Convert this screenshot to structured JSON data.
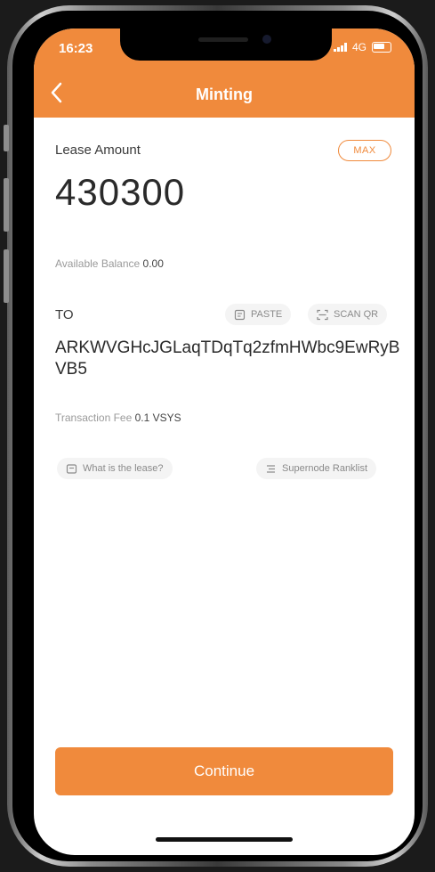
{
  "status_bar": {
    "time": "16:23",
    "network": "4G"
  },
  "header": {
    "title": "Minting",
    "back_icon": "chevron-left-icon"
  },
  "lease": {
    "label": "Lease Amount",
    "max_label": "MAX",
    "amount": "430300",
    "available_label": "Available Balance",
    "available_value": "0.00"
  },
  "to": {
    "label": "TO",
    "paste_label": "PASTE",
    "scan_label": "SCAN QR",
    "address": "ARKWVGHcJGLaqTDqTq2zfmHWbc9EwRyBVB5"
  },
  "fee": {
    "label": "Transaction Fee",
    "value": "0.1 VSYS"
  },
  "links": {
    "lease_help": "What is the lease?",
    "supernode": "Supernode Ranklist"
  },
  "continue_label": "Continue",
  "colors": {
    "accent": "#f08a3c"
  }
}
